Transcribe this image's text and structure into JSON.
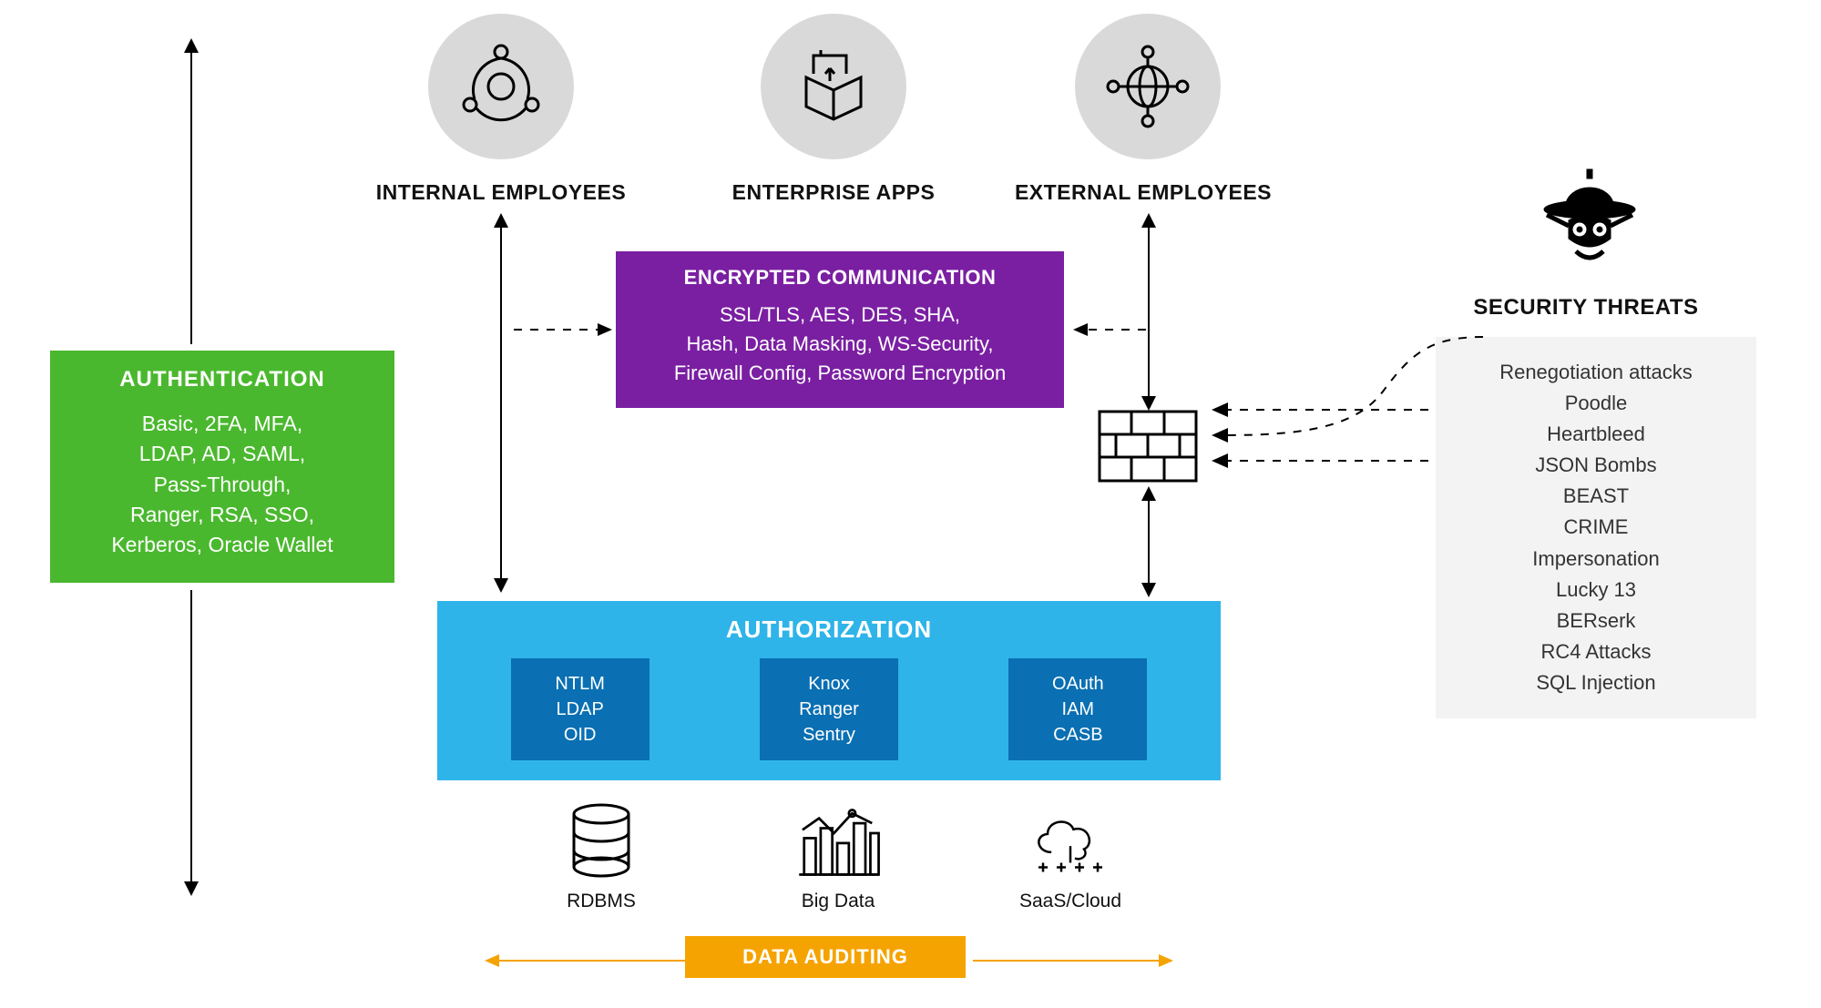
{
  "actors": {
    "internal": "INTERNAL EMPLOYEES",
    "apps": "ENTERPRISE APPS",
    "external": "EXTERNAL EMPLOYEES"
  },
  "authentication": {
    "title": "AUTHENTICATION",
    "line1": "Basic, 2FA, MFA,",
    "line2": "LDAP, AD, SAML,",
    "line3": "Pass-Through,",
    "line4": "Ranger, RSA, SSO,",
    "line5": "Kerberos, Oracle Wallet"
  },
  "encryption": {
    "title": "ENCRYPTED COMMUNICATION",
    "line1": "SSL/TLS, AES, DES, SHA,",
    "line2": "Hash, Data Masking, WS-Security,",
    "line3": "Firewall Config, Password Encryption"
  },
  "authorization": {
    "title": "AUTHORIZATION",
    "group1": {
      "a": "NTLM",
      "b": "LDAP",
      "c": "OID"
    },
    "group2": {
      "a": "Knox",
      "b": "Ranger",
      "c": "Sentry"
    },
    "group3": {
      "a": "OAuth",
      "b": "IAM",
      "c": "CASB"
    }
  },
  "sources": {
    "rdbms": "RDBMS",
    "bigdata": "Big Data",
    "saas": "SaaS/Cloud"
  },
  "auditing": {
    "label": "DATA AUDITING"
  },
  "threats": {
    "title": "SECURITY THREATS",
    "items": {
      "t1": "Renegotiation attacks",
      "t2": "Poodle",
      "t3": "Heartbleed",
      "t4": "JSON Bombs",
      "t5": "BEAST",
      "t6": "CRIME",
      "t7": "Impersonation",
      "t8": "Lucky 13",
      "t9": "BERserk",
      "t10": "RC4 Attacks",
      "t11": "SQL Injection"
    }
  }
}
